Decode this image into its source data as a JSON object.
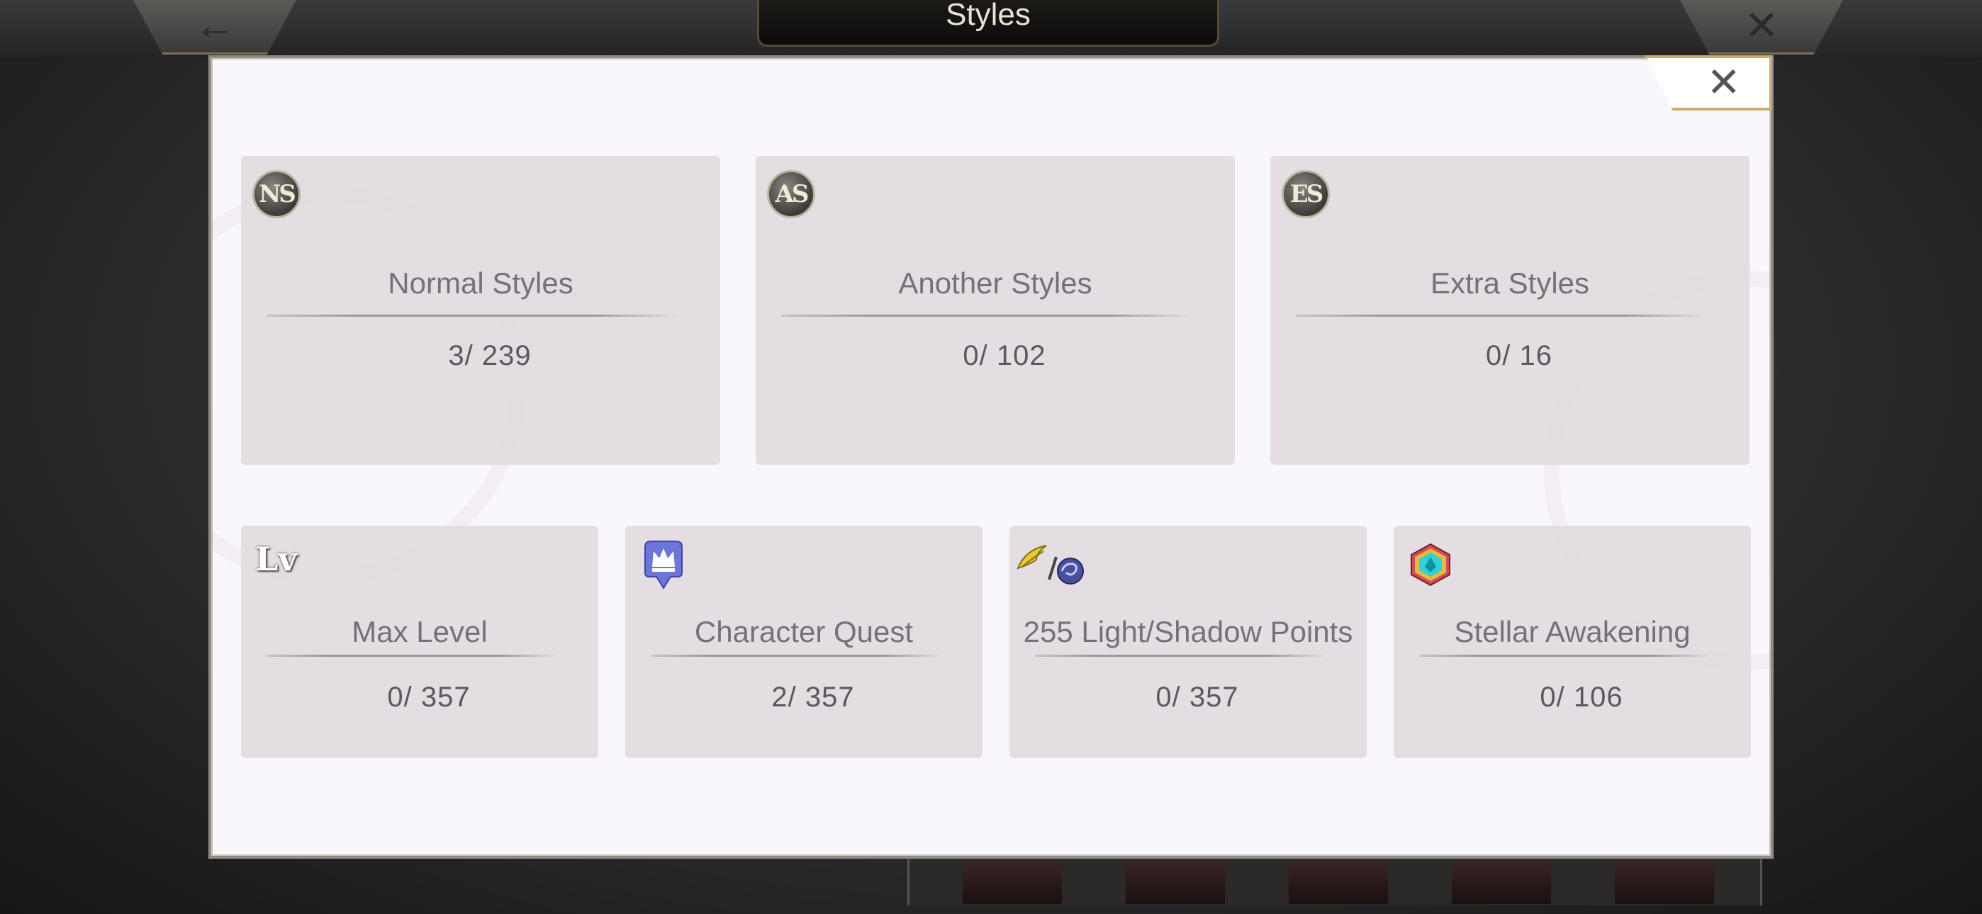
{
  "top_bar": {
    "title": "Styles",
    "back_glyph": "←",
    "close_glyph": "✕"
  },
  "dialog": {
    "close_glyph": "✕",
    "top_cards": [
      {
        "badge": "NS",
        "label": "Normal Styles",
        "count": "3/ 239"
      },
      {
        "badge": "AS",
        "label": "Another Styles",
        "count": "0/ 102"
      },
      {
        "badge": "ES",
        "label": "Extra Styles",
        "count": "0/ 16"
      }
    ],
    "bottom_cards": [
      {
        "icon": "level-icon",
        "icon_text": "Lv",
        "label": "Max Level",
        "count": "0/ 357"
      },
      {
        "icon": "crown-marker-icon",
        "label": "Character Quest",
        "count": "2/ 357"
      },
      {
        "icon": "light-shadow-icon",
        "label": "255 Light/Shadow Points",
        "count": "0/ 357"
      },
      {
        "icon": "hexagon-gem-icon",
        "label": "Stellar Awakening",
        "count": "0/ 106"
      }
    ]
  },
  "colors": {
    "card_bg": "#e2dade",
    "label_text": "#77707a",
    "dialog_bg": "#f9f7fb",
    "gold_border": "#c7ad6b"
  }
}
